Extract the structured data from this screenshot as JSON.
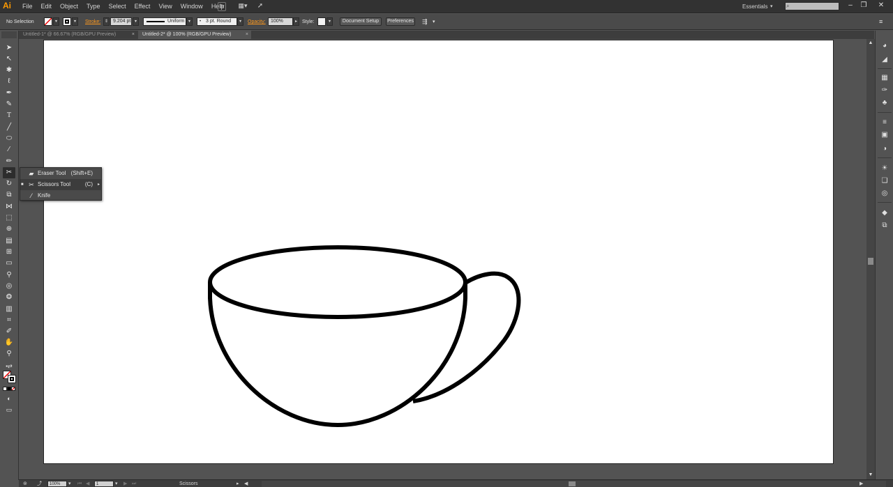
{
  "app": {
    "logo": "Ai",
    "menus": [
      "File",
      "Edit",
      "Object",
      "Type",
      "Select",
      "Effect",
      "View",
      "Window",
      "Help"
    ],
    "bridge_label": "Br",
    "workspace": "Essentials",
    "search_placeholder": ""
  },
  "control_bar": {
    "selection": "No Selection",
    "stroke_label": "Stroke:",
    "stroke_weight": "9.204 pt",
    "profile": "Uniform",
    "brush": "3 pt. Round",
    "opacity_label": "Opacity:",
    "opacity_value": "100%",
    "style_label": "Style:",
    "document_setup": "Document Setup",
    "preferences": "Preferences"
  },
  "tabs": [
    {
      "label": "Untitled-1* @ 66.67% (RGB/GPU Preview)",
      "active": false
    },
    {
      "label": "Untitled-2* @ 100% (RGB/GPU Preview)",
      "active": true
    }
  ],
  "flyout": {
    "items": [
      {
        "label": "Eraser Tool",
        "shortcut": "(Shift+E)",
        "icon": "eraser-icon",
        "selected": false
      },
      {
        "label": "Scissors Tool",
        "shortcut": "(C)",
        "icon": "scissors-icon",
        "selected": true
      },
      {
        "label": "Knife",
        "shortcut": "",
        "icon": "knife-icon",
        "selected": false
      }
    ]
  },
  "status_bar": {
    "zoom": "100%",
    "artboard_number": "1",
    "current_tool": "Scissors"
  },
  "colors": {
    "accent_orange": "#ff9a1e",
    "artboard": "#ffffff",
    "workspace_bg": "#535353",
    "stroke": "#000000"
  }
}
